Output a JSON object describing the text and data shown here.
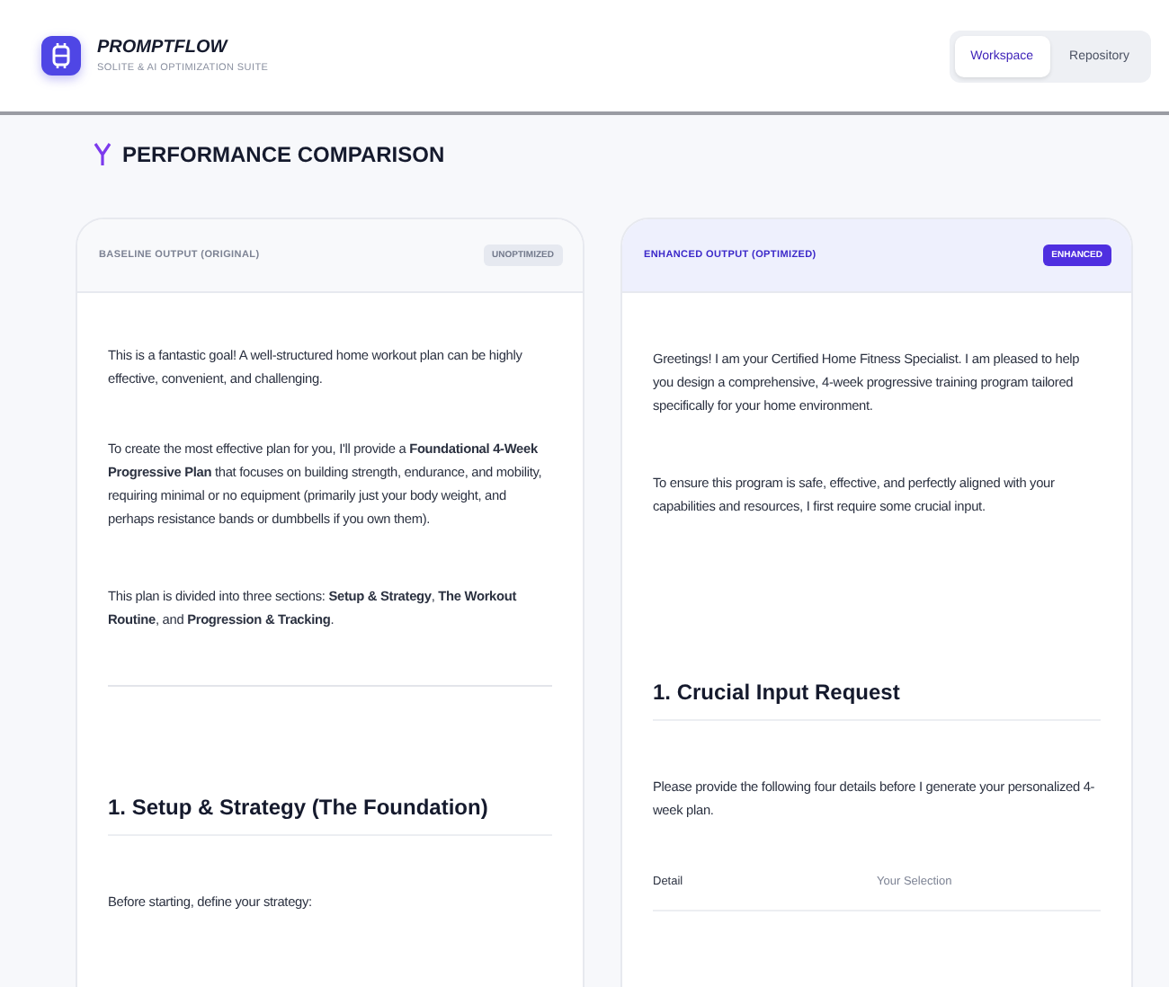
{
  "app": {
    "name": "PROMPTFLOW",
    "subtitle": "SOLITE & AI OPTIMIZATION SUITE"
  },
  "tabs": [
    {
      "label": "Workspace",
      "selected": true
    },
    {
      "label": "Repository",
      "selected": false
    }
  ],
  "section_title": "PERFORMANCE COMPARISON",
  "panels": [
    {
      "kind": "baseline",
      "title": "BASELINE OUTPUT (ORIGINAL)",
      "badge": "UNOPTIMIZED",
      "blocks": [
        {
          "kind": "p",
          "text": "This is a fantastic goal! A well-structured home workout plan can be highly effective, convenient, and challenging."
        },
        {
          "kind": "p",
          "text": "To create the most effective plan for you, I'll provide a **Foundational 4-Week Progressive Plan** that focuses on building strength, endurance, and mobility, requiring minimal or no equipment (primarily just your body weight, and perhaps resistance bands or dumbbells if you own them)."
        },
        {
          "kind": "p",
          "text": "This plan is divided into three sections: **Setup & Strategy**, **The Workout Routine**, and **Progression & Tracking**."
        },
        {
          "kind": "hr"
        },
        {
          "kind": "h",
          "text": "1. Setup & Strategy (The Foundation)"
        },
        {
          "kind": "p",
          "text": "Before starting, define your strategy:"
        }
      ]
    },
    {
      "kind": "enhanced",
      "title": "ENHANCED OUTPUT (OPTIMIZED)",
      "badge": "ENHANCED",
      "blocks": [
        {
          "kind": "p",
          "text": "Greetings! I am your Certified Home Fitness Specialist. I am pleased to help you design a comprehensive, 4-week progressive training program tailored specifically for your home environment."
        },
        {
          "kind": "p",
          "text": "To ensure this program is safe, effective, and perfectly aligned with your capabilities and resources, I first require some crucial input."
        },
        {
          "kind": "h",
          "text": "1. Crucial Input Request"
        },
        {
          "kind": "p",
          "text": "Please provide the following four details before I generate your personalized 4-week plan."
        },
        {
          "kind": "th",
          "cells": [
            "Detail",
            "Your Selection"
          ]
        }
      ]
    }
  ]
}
